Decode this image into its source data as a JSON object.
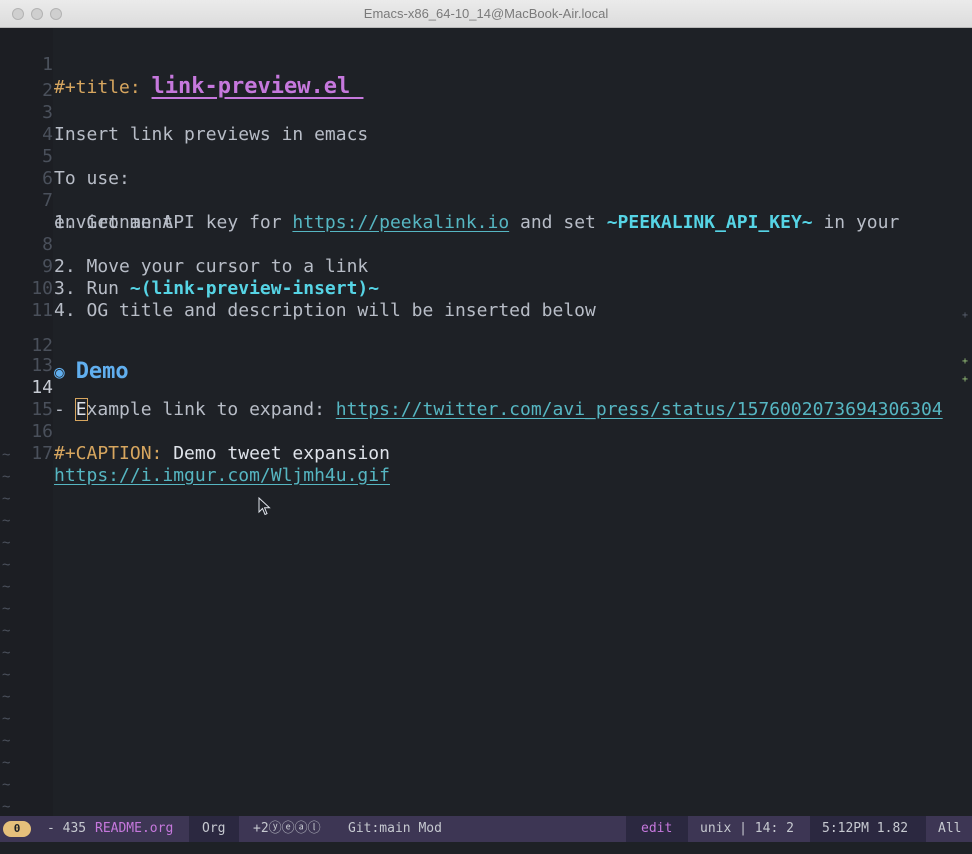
{
  "window": {
    "title": "Emacs-x86_64-10_14@MacBook-Air.local"
  },
  "lines": [
    {
      "n": "1",
      "meta": "#+title: ",
      "title": "link-preview.el "
    },
    {
      "n": "2"
    },
    {
      "n": "3",
      "text": "Insert link previews in emacs"
    },
    {
      "n": "4"
    },
    {
      "n": "5",
      "text": "To use:"
    },
    {
      "n": "6"
    },
    {
      "n": "7",
      "p1": "1. Get an API key for ",
      "link": "https://peekalink.io",
      "p2": " and set ",
      "code": "~PEEKALINK_API_KEY~",
      "p3": " in your",
      "wrap": "environment"
    },
    {
      "n": "",
      "text": ""
    },
    {
      "n": "8",
      "text": "2. Move your cursor to a link"
    },
    {
      "n": "9",
      "p1": "3. Run ",
      "code": "~(link-preview-insert)~"
    },
    {
      "n": "10",
      "text": "4. OG title and description will be inserted below"
    },
    {
      "n": "11"
    },
    {
      "n": "12",
      "bullet": "◉",
      "heading": "Demo"
    },
    {
      "n": "13"
    },
    {
      "n": "14",
      "p1": "- ",
      "cursor": "E",
      "p2": "xample link to expand: ",
      "link": "https://twitter.com/avi_press/status/1576002073694306304"
    },
    {
      "n": "15"
    },
    {
      "n": "16",
      "meta": "#+CAPTION: ",
      "caption": "Demo tweet expansion"
    },
    {
      "n": "17",
      "link": "https://i.imgur.com/Wljmh4u.gif"
    }
  ],
  "tilde": "~",
  "fringe_plus": "+",
  "modeline": {
    "badge": "0",
    "dash": "- 435 ",
    "file": "README.org",
    "mode": "Org",
    "icons": "+2ⓨⓔⓐⓛ",
    "git": "Git:main Mod",
    "edit": "edit",
    "encoding": "unix | 14: 2",
    "time": "5:12PM 1.82",
    "position": "All"
  }
}
